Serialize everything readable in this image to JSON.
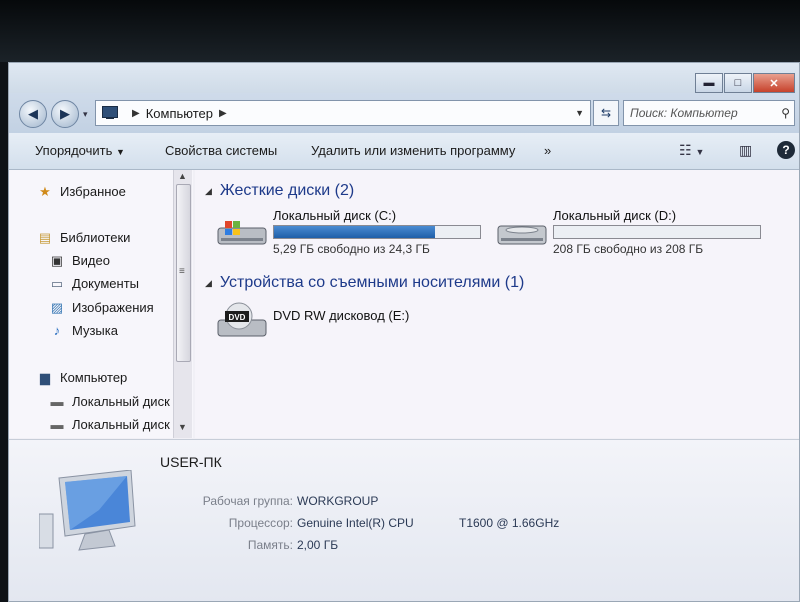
{
  "window": {
    "caption_buttons": {
      "minimize": "▬",
      "maximize": "□",
      "close": "✕"
    }
  },
  "address_bar": {
    "path_item": "Компьютер",
    "search_placeholder": "Поиск: Компьютер"
  },
  "command_bar": {
    "organize": "Упорядочить",
    "system_properties": "Свойства системы",
    "uninstall": "Удалить или изменить программу",
    "more": "»"
  },
  "nav_pane": {
    "favorites": "Избранное",
    "libraries": "Библиотеки",
    "library_items": [
      "Видео",
      "Документы",
      "Изображения",
      "Музыка"
    ],
    "computer": "Компьютер",
    "computer_items": [
      "Локальный диск",
      "Локальный диск"
    ]
  },
  "content": {
    "hdd_group": "Жесткие диски (2)",
    "drives": [
      {
        "name": "Локальный диск (C:)",
        "free_text": "5,29 ГБ свободно из 24,3 ГБ",
        "used_fraction": 0.78
      },
      {
        "name": "Локальный диск (D:)",
        "free_text": "208 ГБ свободно из 208 ГБ",
        "used_fraction": 0.0
      }
    ],
    "removable_group": "Устройства со съемными носителями (1)",
    "dvd": {
      "name": "DVD RW дисковод (E:)",
      "badge": "DVD"
    }
  },
  "details": {
    "computer_name": "USER-ПК",
    "workgroup_label": "Рабочая группа:",
    "workgroup_value": "WORKGROUP",
    "cpu_label": "Процессор:",
    "cpu_value": "Genuine Intel(R) CPU",
    "cpu_model": "T1600  @ 1.66GHz",
    "memory_label": "Память:",
    "memory_value": "2,00 ГБ"
  },
  "colors": {
    "accent": "#1e3a8a",
    "bar_fill": "#1f5fa8"
  }
}
